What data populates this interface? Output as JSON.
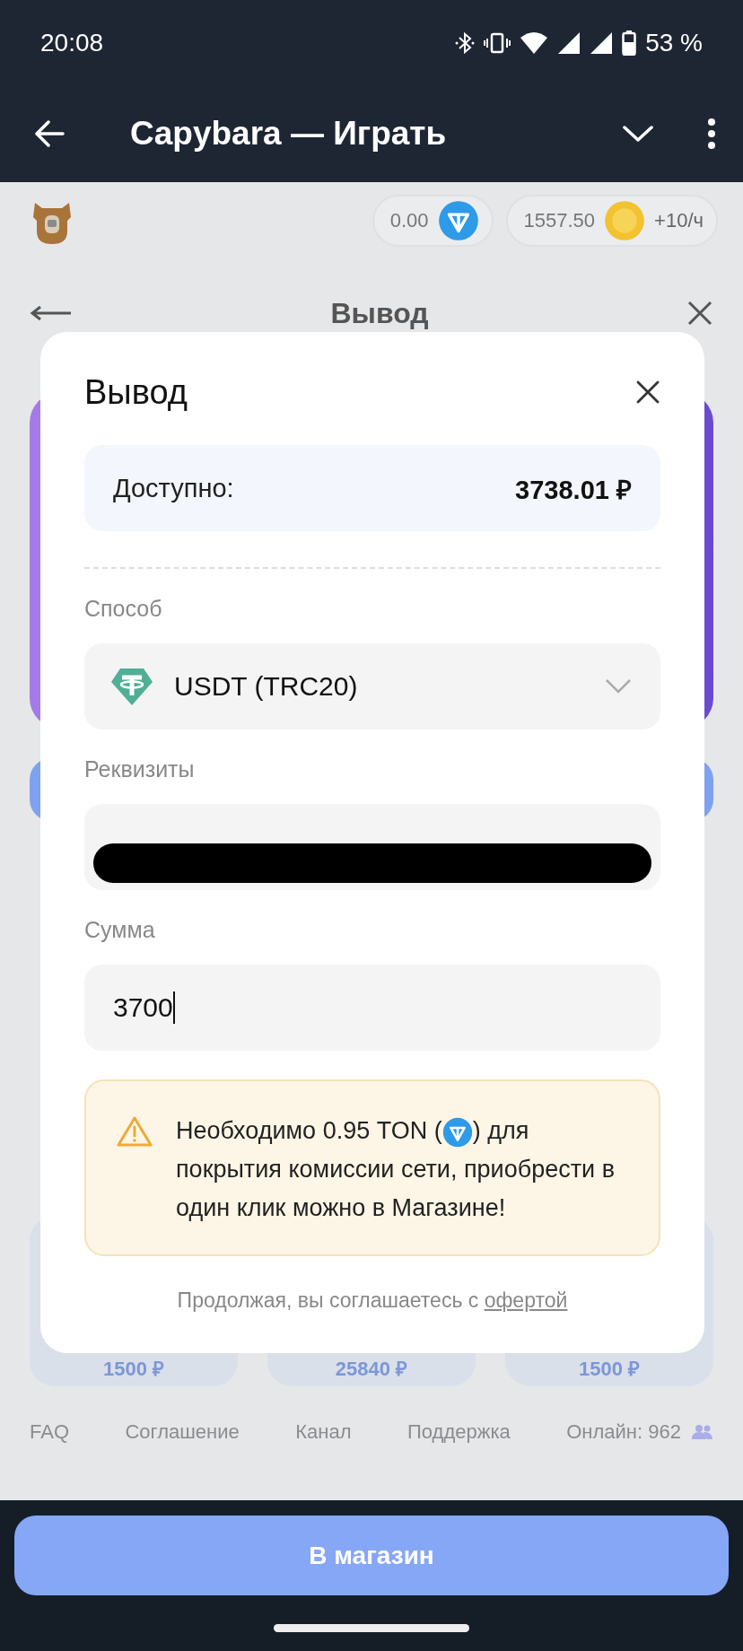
{
  "status_bar": {
    "time": "20:08",
    "battery": "53 %"
  },
  "app_bar": {
    "title": "Capybara — Играть"
  },
  "background_page": {
    "balances": [
      {
        "kind": "ton",
        "amount": "0.00"
      },
      {
        "kind": "coin",
        "amount": "1557.50",
        "rate": "+10/ч"
      }
    ],
    "heading": "Вывод",
    "cards": [
      {
        "price": "1500 ₽"
      },
      {
        "price": "25840 ₽"
      },
      {
        "price": "1500 ₽"
      }
    ],
    "footer_links": [
      "FAQ",
      "Соглашение",
      "Канал",
      "Поддержка"
    ],
    "online": "Онлайн: 962"
  },
  "dialog": {
    "title": "Вывод",
    "available_label": "Доступно:",
    "available_amount": "3738.01 ₽",
    "method_label": "Способ",
    "method": "USDT (TRC20)",
    "requisites_label": "Реквизиты",
    "requisites_redacted": true,
    "amount_label": "Сумма",
    "amount": "3700",
    "warning_before": "Необходимо 0.95 TON (",
    "warning_after": ") для покрытия комиссии сети, приобрести в один клик можно в Магазине!",
    "terms_text": "Продолжая, вы соглашаетесь с",
    "terms_link": "офертой"
  },
  "bottom_button": "В магазин"
}
